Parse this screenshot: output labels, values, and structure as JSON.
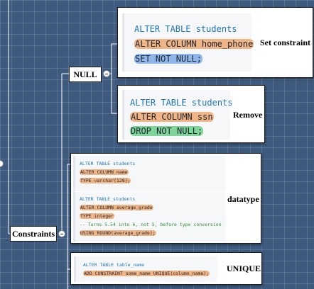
{
  "nodes": {
    "null_label": "NULL",
    "constraints_label": "Constraints"
  },
  "cards": {
    "set_constraint": {
      "label": "Set constraint",
      "lines": [
        "ALTER TABLE students",
        "ALTER COLUMN home_phone",
        "SET NOT NULL;"
      ]
    },
    "remove": {
      "label": "Remove",
      "lines": [
        "ALTER TABLE students",
        "ALTER COLUMN ssn",
        "DROP NOT NULL;"
      ]
    },
    "datatype": {
      "label": "datatype",
      "block1": [
        "ALTER TABLE students",
        "ALTER COLUMN name",
        "TYPE varchar(128);"
      ],
      "block2": [
        "ALTER TABLE students",
        "ALTER COLUMN average_grade",
        "TYPE integer",
        "-- Turns 5.54 into 6, not 5, before type conversion",
        "USING ROUND(average_grade);"
      ]
    },
    "unique": {
      "label": "UNIQUE",
      "lines": [
        "ALTER TABLE table_name",
        "ADD CONSTRAINT some_name UNIQUE(column_name);"
      ]
    }
  },
  "colors": {
    "background": "#3e5a7e",
    "keyword": "#1f74b8",
    "keyword_secondary": "#b8487c",
    "comment": "#2e8b2e",
    "highlight_orange": "#f0b586",
    "highlight_blue": "#8fb6e8",
    "highlight_green": "#7fd49a"
  }
}
